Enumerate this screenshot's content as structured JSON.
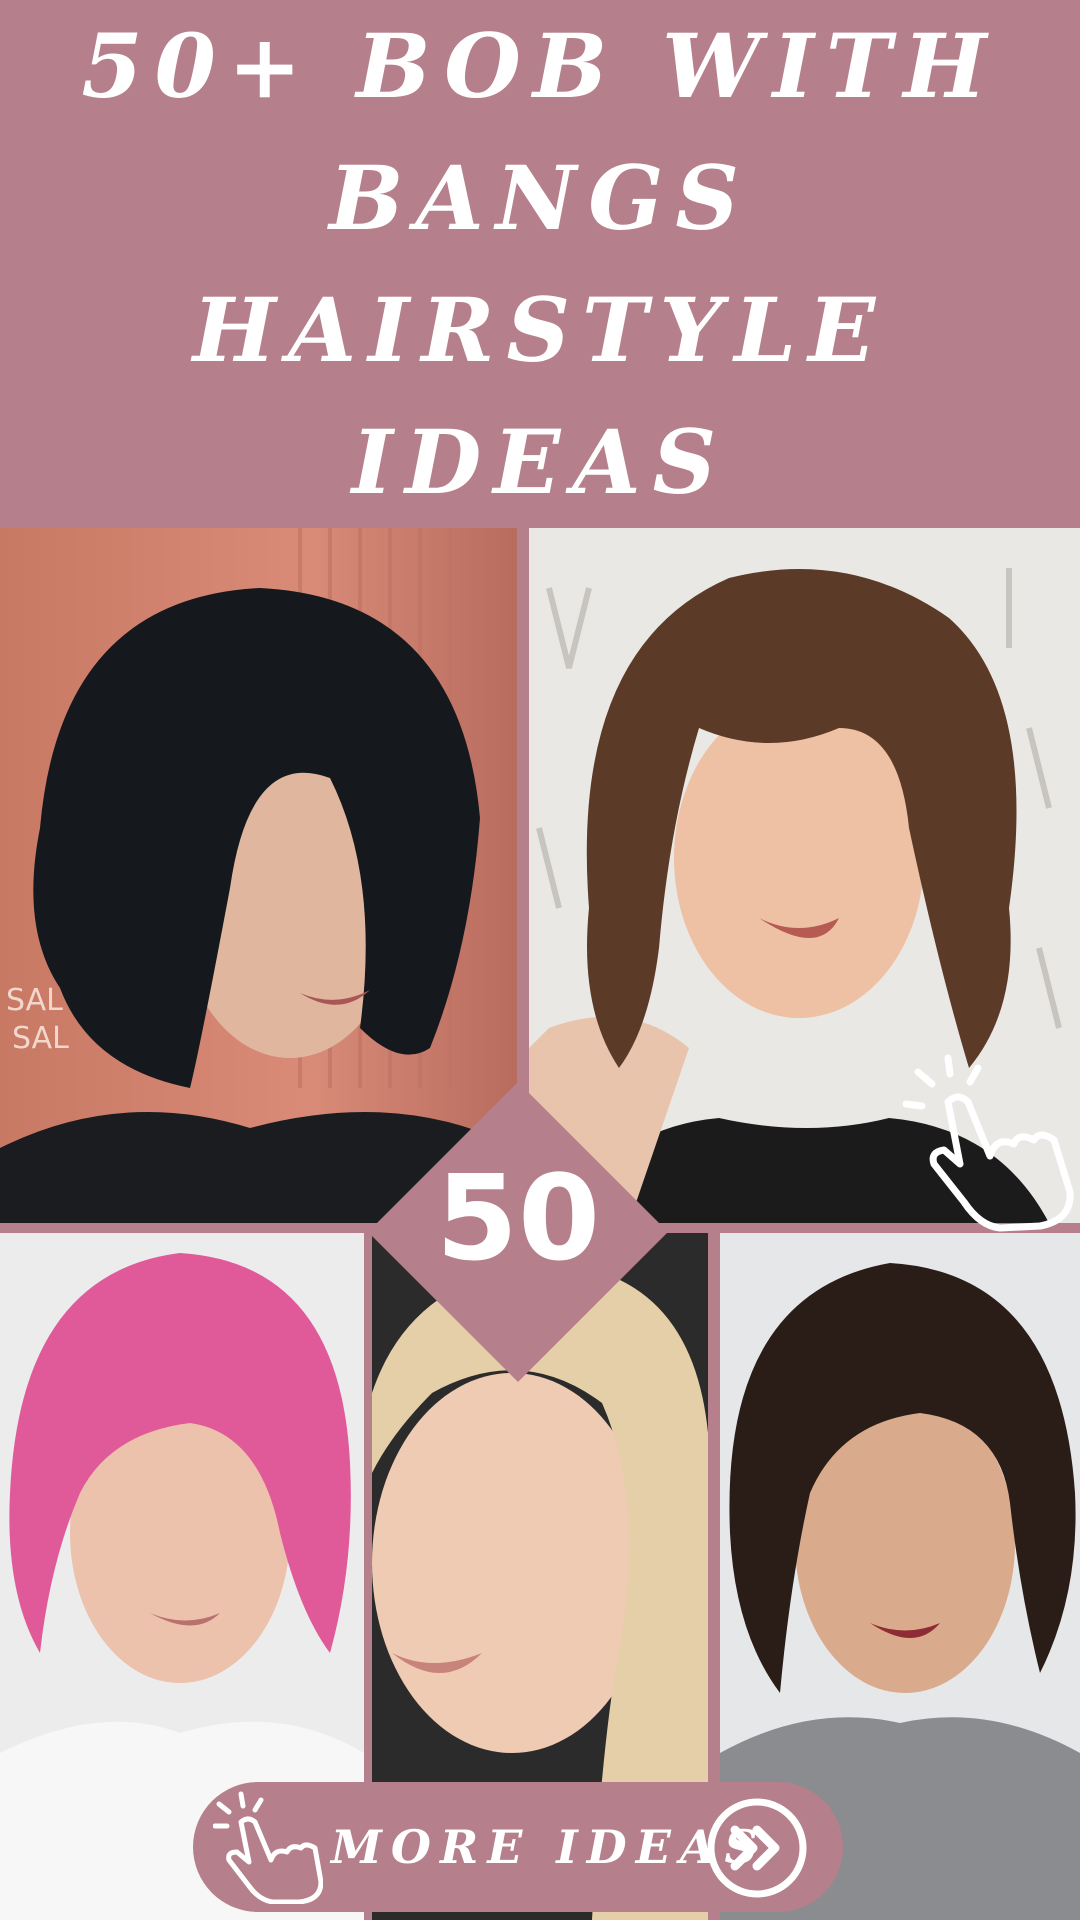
{
  "header": {
    "title": "50+ BOB WITH BANGS HAIRSTYLE IDEAS",
    "background": "#b5808c"
  },
  "badge": {
    "number": "50"
  },
  "cta": {
    "label": "MORE IDEAS",
    "icons": [
      "hand-pointer-icon",
      "double-chevron-right-icon"
    ]
  },
  "photos": [
    {
      "name": "black-layered-bob",
      "watermark": [
        "SAL",
        "SAL"
      ]
    },
    {
      "name": "brown-wavy-bob-with-bangs"
    },
    {
      "name": "pink-bob-with-bangs"
    },
    {
      "name": "blonde-bob-with-curtain-bangs"
    },
    {
      "name": "dark-curly-bob-with-bangs"
    }
  ],
  "colors": {
    "accent": "#b5808c",
    "text": "#ffffff"
  }
}
